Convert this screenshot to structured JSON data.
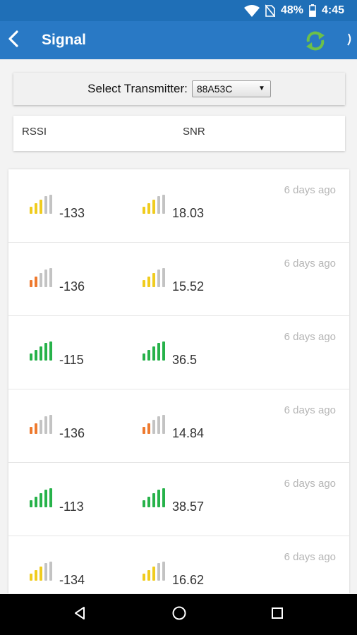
{
  "status": {
    "battery": "48%",
    "time": "4:45"
  },
  "appbar": {
    "title": "Signal"
  },
  "selector": {
    "label": "Select Transmitter:",
    "value": "88A53C"
  },
  "columns": {
    "rssi": "RSSI",
    "snr": "SNR"
  },
  "colors": {
    "appbar": "#2979c5",
    "statusbar": "#1f6fb7",
    "green": "#27b24a",
    "yellow": "#f0cc1e",
    "orange": "#ee7a2f",
    "gray": "#c3c3c3",
    "refresh": "#6cc04a"
  },
  "readings": [
    {
      "rssi": "-133",
      "rssi_level": 3,
      "rssi_color": "yellow",
      "snr": "18.03",
      "snr_level": 3,
      "snr_color": "yellow",
      "time": "6 days ago"
    },
    {
      "rssi": "-136",
      "rssi_level": 2,
      "rssi_color": "orange",
      "snr": "15.52",
      "snr_level": 3,
      "snr_color": "yellow",
      "time": "6 days ago"
    },
    {
      "rssi": "-115",
      "rssi_level": 5,
      "rssi_color": "green",
      "snr": "36.5",
      "snr_level": 5,
      "snr_color": "green",
      "time": "6 days ago"
    },
    {
      "rssi": "-136",
      "rssi_level": 2,
      "rssi_color": "orange",
      "snr": "14.84",
      "snr_level": 2,
      "snr_color": "orange",
      "time": "6 days ago"
    },
    {
      "rssi": "-113",
      "rssi_level": 5,
      "rssi_color": "green",
      "snr": "38.57",
      "snr_level": 5,
      "snr_color": "green",
      "time": "6 days ago"
    },
    {
      "rssi": "-134",
      "rssi_level": 3,
      "rssi_color": "yellow",
      "snr": "16.62",
      "snr_level": 3,
      "snr_color": "yellow",
      "time": "6 days ago"
    }
  ],
  "icons": {
    "back": "chevron-left-icon",
    "refresh": "refresh-icon",
    "more": "overflow-icon",
    "wifi": "wifi-icon",
    "sim": "no-sim-icon",
    "battery": "battery-icon",
    "nav_back": "triangle-back-icon",
    "nav_home": "circle-home-icon",
    "nav_recent": "square-recents-icon"
  }
}
